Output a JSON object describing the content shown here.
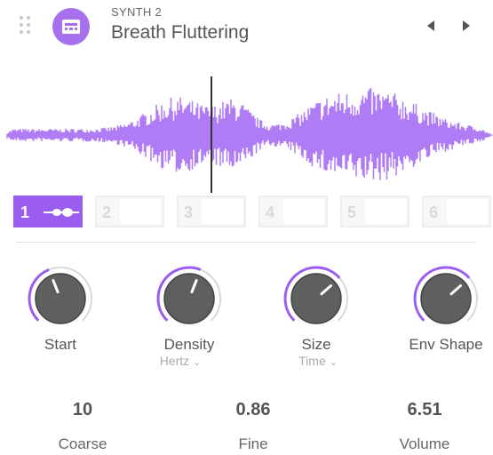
{
  "header": {
    "engine_label": "SYNTH 2",
    "preset_name": "Breath Fluttering",
    "icon": "synth-preset-icon",
    "prev_icon": "triangle-left-icon",
    "next_icon": "triangle-right-icon"
  },
  "colors": {
    "accent": "#9b5cf0",
    "waveform": "#b07cf5",
    "knob_body": "#5f5f5f"
  },
  "slots": [
    {
      "number": "1",
      "active": true
    },
    {
      "number": "2",
      "active": false
    },
    {
      "number": "3",
      "active": false
    },
    {
      "number": "4",
      "active": false
    },
    {
      "number": "5",
      "active": false
    },
    {
      "number": "6",
      "active": false
    }
  ],
  "knobs": [
    {
      "label": "Start",
      "sub": "",
      "level": 0.42
    },
    {
      "label": "Density",
      "sub": "Hertz",
      "level": 0.58
    },
    {
      "label": "Size",
      "sub": "Time",
      "level": 0.68
    },
    {
      "label": "Env Shape",
      "sub": "",
      "level": 0.68
    }
  ],
  "params": [
    {
      "value": "10",
      "label": "Coarse"
    },
    {
      "value": "0.86",
      "label": "Fine"
    },
    {
      "value": "6.51",
      "label": "Volume"
    }
  ]
}
